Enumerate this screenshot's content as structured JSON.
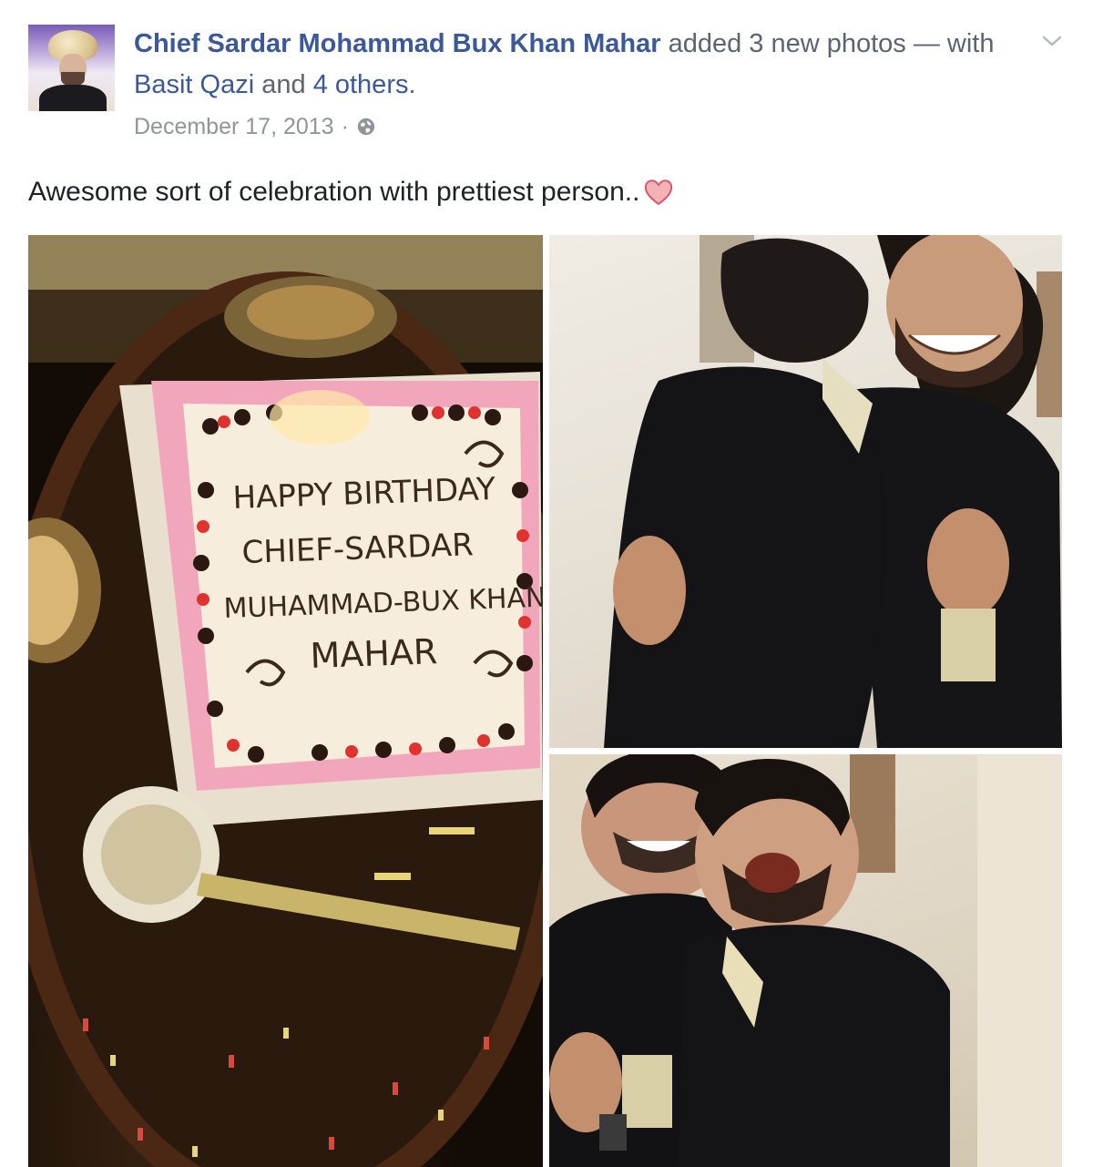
{
  "post": {
    "author": "Chief Sardar Mohammad Bux Khan Mahar",
    "action_text": "added 3 new photos — with",
    "tagged_person": "Basit Qazi",
    "and_text": "and",
    "others_link": "4 others",
    "period": ".",
    "timestamp": "December 17, 2013",
    "separator": "·",
    "privacy_icon": "globe-icon",
    "menu_icon": "chevron-down-icon",
    "caption": "Awesome sort of celebration with prettiest person..",
    "caption_emoji": "heart-icon",
    "photos": [
      {
        "subject": "birthday-cake"
      },
      {
        "subject": "two-men-hugging"
      },
      {
        "subject": "two-men-laughing"
      }
    ],
    "cake_text": [
      "HAPPY BIRTHDAY",
      "CHIEF-SARDAR",
      "MUHAMMAD-BUX KHAN",
      "MAHAR"
    ]
  },
  "colors": {
    "link_blue": "#3b5998",
    "meta_grey": "#90949c",
    "text_dark": "#1d2129"
  }
}
